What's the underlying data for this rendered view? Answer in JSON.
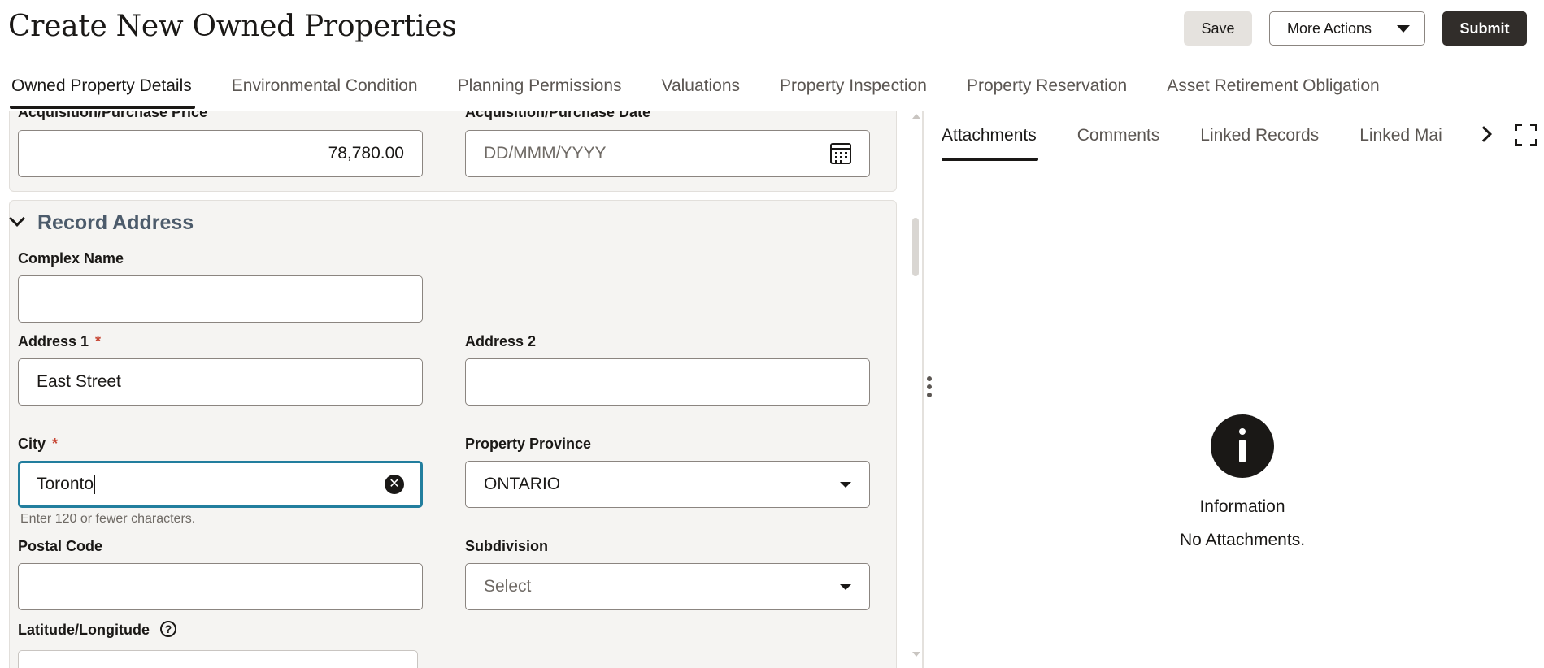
{
  "page": {
    "title": "Create New Owned Properties"
  },
  "header": {
    "save_label": "Save",
    "more_actions_label": "More Actions",
    "submit_label": "Submit"
  },
  "main_tabs": [
    {
      "label": "Owned Property Details",
      "active": true
    },
    {
      "label": "Environmental Condition"
    },
    {
      "label": "Planning Permissions"
    },
    {
      "label": "Valuations"
    },
    {
      "label": "Property Inspection"
    },
    {
      "label": "Property Reservation"
    },
    {
      "label": "Asset Retirement Obligation"
    }
  ],
  "form": {
    "purchase_price": {
      "label": "Acquisition/Purchase Price",
      "value": "78,780.00"
    },
    "purchase_date": {
      "label": "Acquisition/Purchase Date",
      "placeholder": "DD/MMM/YYYY"
    },
    "record_address_title": "Record Address",
    "complex_name": {
      "label": "Complex Name",
      "value": ""
    },
    "address1": {
      "label": "Address 1",
      "required": "*",
      "value": "East Street"
    },
    "address2": {
      "label": "Address 2",
      "value": ""
    },
    "city": {
      "label": "City",
      "required": "*",
      "value": "Toronto",
      "helper": "Enter 120 or fewer characters."
    },
    "province": {
      "label": "Property Province",
      "value": "ONTARIO"
    },
    "postal_code": {
      "label": "Postal Code",
      "value": ""
    },
    "subdivision": {
      "label": "Subdivision",
      "placeholder": "Select"
    },
    "lat_long": {
      "label": "Latitude/Longitude",
      "help": "?"
    }
  },
  "right_panel": {
    "tabs": [
      {
        "label": "Attachments",
        "active": true
      },
      {
        "label": "Comments"
      },
      {
        "label": "Linked Records"
      },
      {
        "label": "Linked Mai"
      }
    ],
    "info_title": "Information",
    "info_message": "No Attachments."
  },
  "icons": {
    "more_actions": "caret-down-icon",
    "date": "calendar-icon",
    "clear": "clear-icon",
    "dropdown": "caret-down-icon",
    "section": "chevron-down-icon",
    "help": "help-icon",
    "tabs_next": "chevron-right-icon",
    "expand": "fullscreen-icon",
    "info": "info-icon"
  },
  "colors": {
    "primary_dark": "#312d2a",
    "focus_border": "#227e9e",
    "required": "#c74634",
    "section_title": "#4c5b6b",
    "panel_bg": "#f5f4f2"
  }
}
